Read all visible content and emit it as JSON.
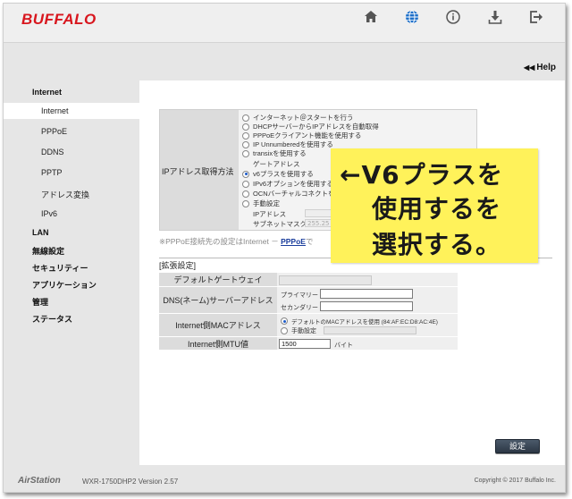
{
  "brand": {
    "logo": "BUFFALO"
  },
  "topbar": {
    "icons": [
      "home-icon",
      "globe-icon",
      "info-icon",
      "download-icon",
      "logout-icon"
    ],
    "active_color": "#1d6fc9"
  },
  "help_label": "Help",
  "sidebar": {
    "internet_heading": "Internet",
    "internet_items": [
      "Internet",
      "PPPoE",
      "DDNS",
      "PPTP",
      "アドレス変換",
      "IPv6"
    ],
    "lan": "LAN",
    "wireless": "無線設定",
    "security": "セキュリティー",
    "application": "アプリケーション",
    "admin": "管理",
    "status": "ステータス"
  },
  "ip_section": {
    "label": "IPアドレス取得方法",
    "options": [
      "インターネット＠スタートを行う",
      "DHCPサーバーからIPアドレスを自動取得",
      "PPPoEクライアント機能を使用する",
      "IP Unnumberedを使用する",
      "transixを使用する"
    ],
    "gateway_label": "ゲートアドレス",
    "option_v6plus": "v6プラスを使用する",
    "option_ipv6": "IPv6オプションを使用する",
    "option_ocn": "OCNバーチャルコネクトを",
    "option_manual": "手動設定",
    "ip_label": "IPアドレス",
    "subnet_label": "サブネットマスク",
    "subnet_value": "255.25"
  },
  "note": {
    "prefix": "※PPPoE接続先の設定はInternet －",
    "link": "PPPoE",
    "suffix": "で"
  },
  "ext": {
    "title": "[拡張設定]",
    "rows": {
      "gateway": "デフォルトゲートウェイ",
      "dns": "DNS(ネーム)サーバーアドレス",
      "dns_primary": "プライマリー",
      "dns_secondary": "セカンダリー",
      "mac": "Internet側MACアドレス",
      "mac_default": "デフォルトのMACアドレスを使用 (84:AF:EC:D8:AC:4E)",
      "mac_manual": "手動設定",
      "mtu": "Internet側MTU値",
      "mtu_value": "1500",
      "mtu_unit": "バイト"
    }
  },
  "save_button": "設定",
  "footer": {
    "brand": "AirStation",
    "model": "WXR-1750DHP2  Version 2.57",
    "copyright": "Copyright © 2017 Buffalo Inc."
  },
  "annotation": {
    "line1": "←V6プラスを",
    "line2": "使用するを",
    "line3": "選択する。"
  }
}
